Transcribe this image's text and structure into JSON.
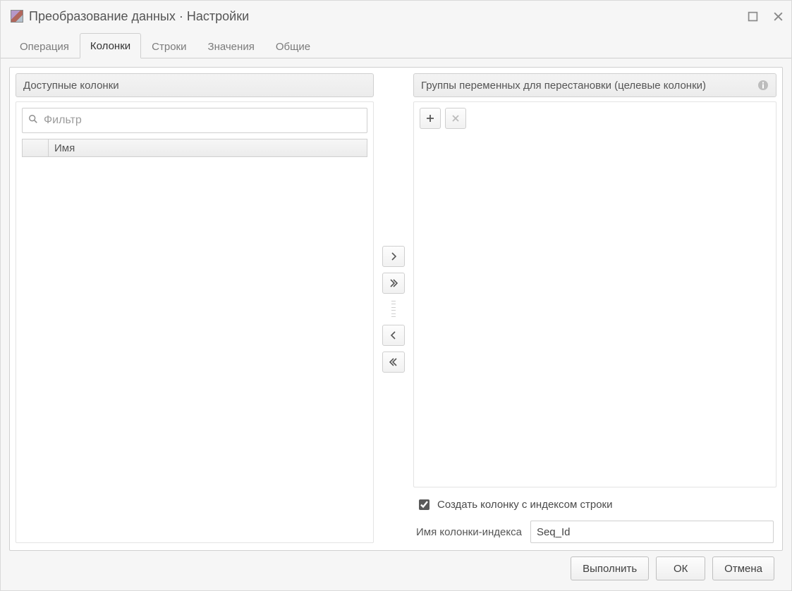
{
  "window": {
    "title": "Преобразование данных · Настройки"
  },
  "tabs": [
    {
      "label": "Операция"
    },
    {
      "label": "Колонки"
    },
    {
      "label": "Строки"
    },
    {
      "label": "Значения"
    },
    {
      "label": "Общие"
    }
  ],
  "active_tab_index": 1,
  "left_panel": {
    "title": "Доступные колонки",
    "filter_placeholder": "Фильтр",
    "column_header": "Имя"
  },
  "right_panel": {
    "title": "Группы переменных для перестановки (целевые колонки)"
  },
  "options": {
    "create_index_checked": true,
    "create_index_label": "Создать колонку с индексом строки",
    "index_name_label": "Имя колонки-индекса",
    "index_name_value": "Seq_Id"
  },
  "footer": {
    "run": "Выполнить",
    "ok": "ОК",
    "cancel": "Отмена"
  }
}
